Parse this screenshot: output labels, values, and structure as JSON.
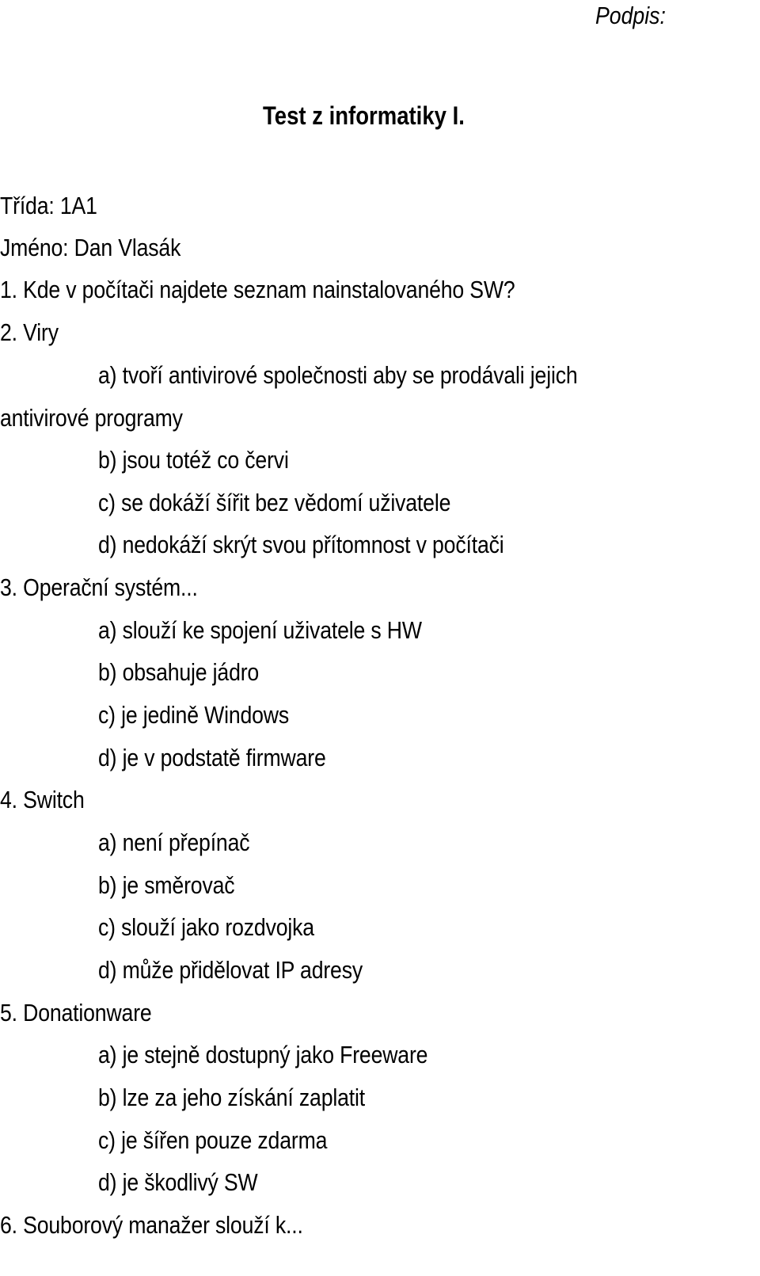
{
  "signature_label": "Podpis:",
  "title": "Test z informatiky I.",
  "info": {
    "class_line": "Třída: 1A1",
    "name_line": "Jméno: Dan Vlasák"
  },
  "questions": [
    {
      "text": "1.  Kde v počítači najdete seznam nainstalovaného SW?",
      "options": []
    },
    {
      "text": "2.  Viry",
      "options": [
        "a) tvoří antivirové společnosti aby se prodávali jejich",
        "b) jsou totéž co červi",
        "c) se dokáží šířit bez vědomí uživatele",
        "d) nedokáží skrýt svou přítomnost v počítači"
      ],
      "option_a_continuation": "antivirové programy"
    },
    {
      "text": "3. Operační systém...",
      "options": [
        "a) slouží ke spojení uživatele s HW",
        "b) obsahuje jádro",
        "c) je jedině Windows",
        "d) je v podstatě firmware"
      ]
    },
    {
      "text": "4. Switch",
      "options": [
        "a) není přepínač",
        "b) je směrovač",
        "c) slouží jako rozdvojka",
        "d) může přidělovat IP adresy"
      ]
    },
    {
      "text": "5. Donationware",
      "options": [
        "a) je stejně dostupný jako Freeware",
        "b) lze za jeho získání zaplatit",
        "c) je šířen pouze zdarma",
        "d) je škodlivý SW"
      ]
    },
    {
      "text": "6. Souborový manažer slouží k...",
      "options": []
    }
  ]
}
